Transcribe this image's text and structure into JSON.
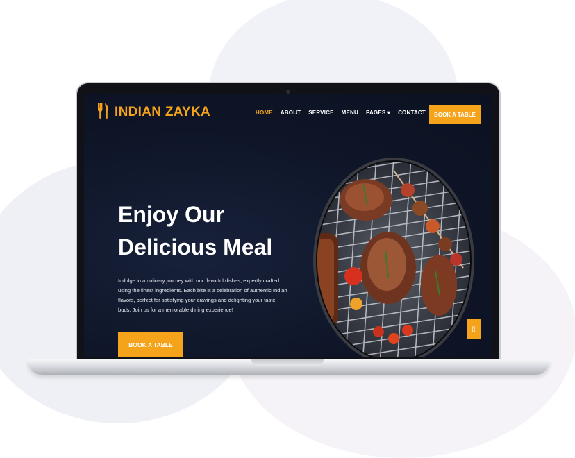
{
  "brand": {
    "name": "INDIAN ZAYKA",
    "icon": "fork-knife-icon",
    "color": "#f4a31a"
  },
  "nav": {
    "items": [
      {
        "label": "HOME",
        "active": true
      },
      {
        "label": "ABOUT",
        "active": false
      },
      {
        "label": "SERVICE",
        "active": false
      },
      {
        "label": "MENU",
        "active": false
      },
      {
        "label": "PAGES ▾",
        "active": false
      },
      {
        "label": "CONTACT",
        "active": false
      }
    ],
    "book_label": "BOOK A TABLE"
  },
  "hero": {
    "title_line1": "Enjoy Our",
    "title_line2": "Delicious Meal",
    "description": "Indulge in a culinary journey with our flavorful dishes, expertly crafted using the finest ingredients. Each bite is a celebration of authentic Indian flavors, perfect for satisfying your cravings and delighting your taste buds. Join us for a memorable dining experience!",
    "book_label": "BOOK A TABLE",
    "image": "grilled-meat-image"
  },
  "back_to_top": {
    "icon": "arrow-up-icon",
    "glyph": "▯"
  },
  "colors": {
    "accent": "#f4a31a",
    "background": "#0f1629",
    "text": "#ffffff"
  }
}
